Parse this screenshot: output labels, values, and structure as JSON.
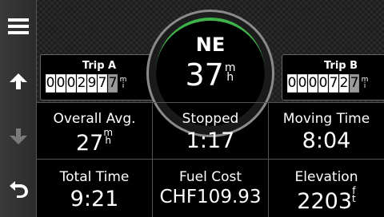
{
  "sidebar": {
    "menu_icon": "menu-icon",
    "up_icon": "arrow-up-icon",
    "down_icon": "arrow-down-icon",
    "back_icon": "back-icon"
  },
  "compass": {
    "heading": "NE",
    "speed": "37",
    "speed_unit_top": "m",
    "speed_unit_bottom": "h",
    "accent_color": "#3fb34a"
  },
  "trip_a": {
    "label": "Trip A",
    "digits": [
      "0",
      "0",
      "0",
      "2",
      "9",
      "7",
      "7"
    ],
    "unit_top": "m",
    "unit_bottom": "i"
  },
  "trip_b": {
    "label": "Trip B",
    "digits": [
      "0",
      "0",
      "0",
      "0",
      "7",
      "2",
      "7"
    ],
    "unit_top": "m",
    "unit_bottom": "i"
  },
  "fields": [
    {
      "label": "Overall Avg.",
      "value": "27",
      "unit_top": "m",
      "unit_bottom": "h"
    },
    {
      "label": "Stopped",
      "value": "1:17"
    },
    {
      "label": "Moving Time",
      "value": "8:04"
    },
    {
      "label": "Total Time",
      "value": "9:21"
    },
    {
      "label": "Fuel Cost",
      "value": "CHF109.93"
    },
    {
      "label": "Elevation",
      "value": "2203",
      "unit_top": "f",
      "unit_bottom": "t"
    }
  ]
}
